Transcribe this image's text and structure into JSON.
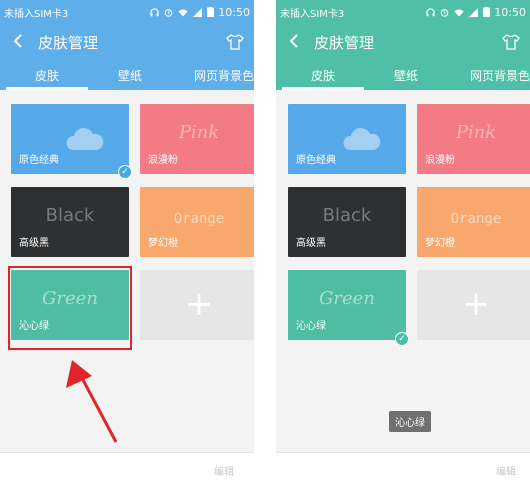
{
  "status_bar": {
    "carrier": "未插入SIM卡3",
    "icons": [
      "headphone-icon",
      "alarm-icon",
      "wifi-icon",
      "signal-icon",
      "battery-icon"
    ],
    "time": "10:50"
  },
  "header": {
    "title": "皮肤管理",
    "back_icon": "back-chevron-icon",
    "shirt_icon": "tshirt-icon"
  },
  "tabs": [
    "皮肤",
    "壁纸",
    "网页背景色"
  ],
  "skins": [
    {
      "label": "原色经典",
      "art": "",
      "color": "#56a9e9"
    },
    {
      "label": "浪漫粉",
      "art": "Pink",
      "color": "#f27b86"
    },
    {
      "label": "高级黑",
      "art": "Black",
      "color": "#2f3032"
    },
    {
      "label": "梦幻橙",
      "art": "Orange",
      "color": "#f8a86d"
    },
    {
      "label": "沁心绿",
      "art": "Green",
      "color": "#4fbca4"
    }
  ],
  "add_card": {
    "symbol": "+"
  },
  "footer": {
    "edit_label": "编辑"
  },
  "toast": {
    "text": "沁心绿"
  },
  "theme_colors": {
    "left_header": "#5daee9",
    "right_header": "#4fbfa7",
    "check_badge": "#4aa8e0",
    "highlight": "#e0242a"
  },
  "selected": {
    "left_panel": "原色经典",
    "right_panel": "沁心绿"
  }
}
